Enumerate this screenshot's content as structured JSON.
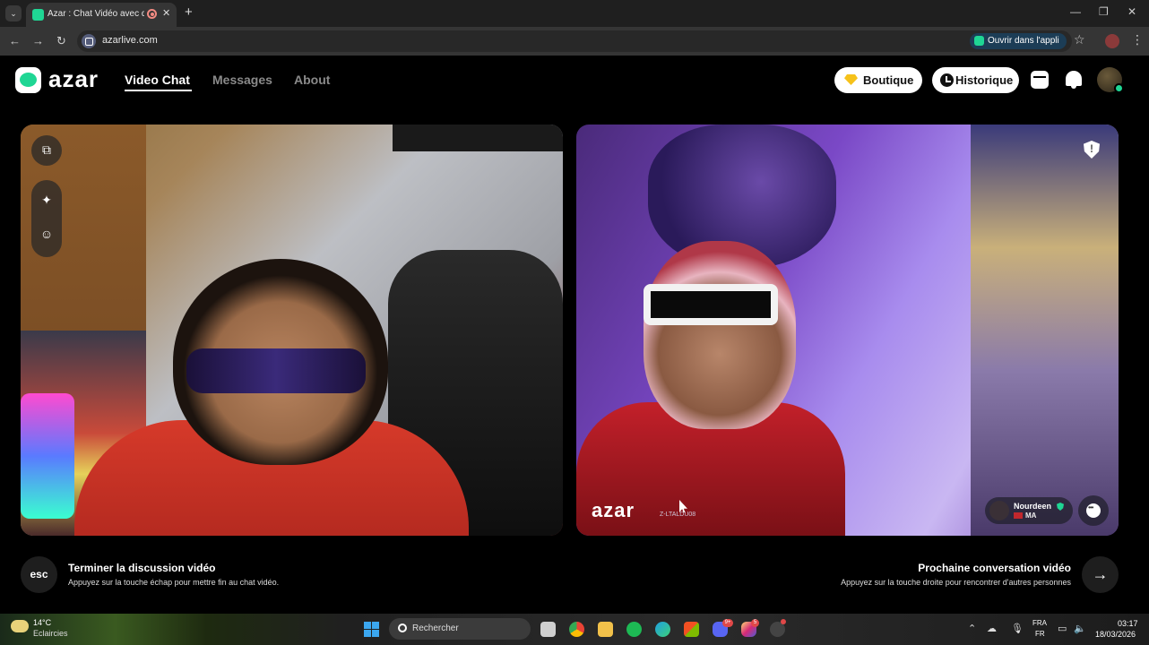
{
  "browser": {
    "tab_title": "Azar : Chat Vidéo avec de n",
    "url": "azarlive.com",
    "open_app_label": "Ouvrir dans l'appli"
  },
  "header": {
    "logo_text": "azar",
    "nav": {
      "video_chat": "Video Chat",
      "messages": "Messages",
      "about": "About"
    },
    "shop_label": "Boutique",
    "history_label": "Historique"
  },
  "partner": {
    "watermark_logo": "azar",
    "watermark_id": "Z-LTALDU08",
    "name": "Nourdeen",
    "country": "MA"
  },
  "bottom": {
    "esc_label": "esc",
    "end_title": "Terminer la discussion vidéo",
    "end_subtitle": "Appuyez sur la touche échap pour mettre fin au chat vidéo.",
    "next_title": "Prochaine conversation vidéo",
    "next_subtitle": "Appuyez sur la touche droite pour rencontrer d'autres personnes"
  },
  "taskbar": {
    "temperature": "14°C",
    "weather": "Eclaircies",
    "search_placeholder": "Rechercher",
    "discord_badge": "9+",
    "instagram_badge": "5",
    "lang_top": "FRA",
    "lang_bottom": "FR",
    "time": "03:17",
    "date": "18/03/2026"
  },
  "colors": {
    "brand_green": "#1fd694",
    "shop_gem": "#f6c21a"
  }
}
